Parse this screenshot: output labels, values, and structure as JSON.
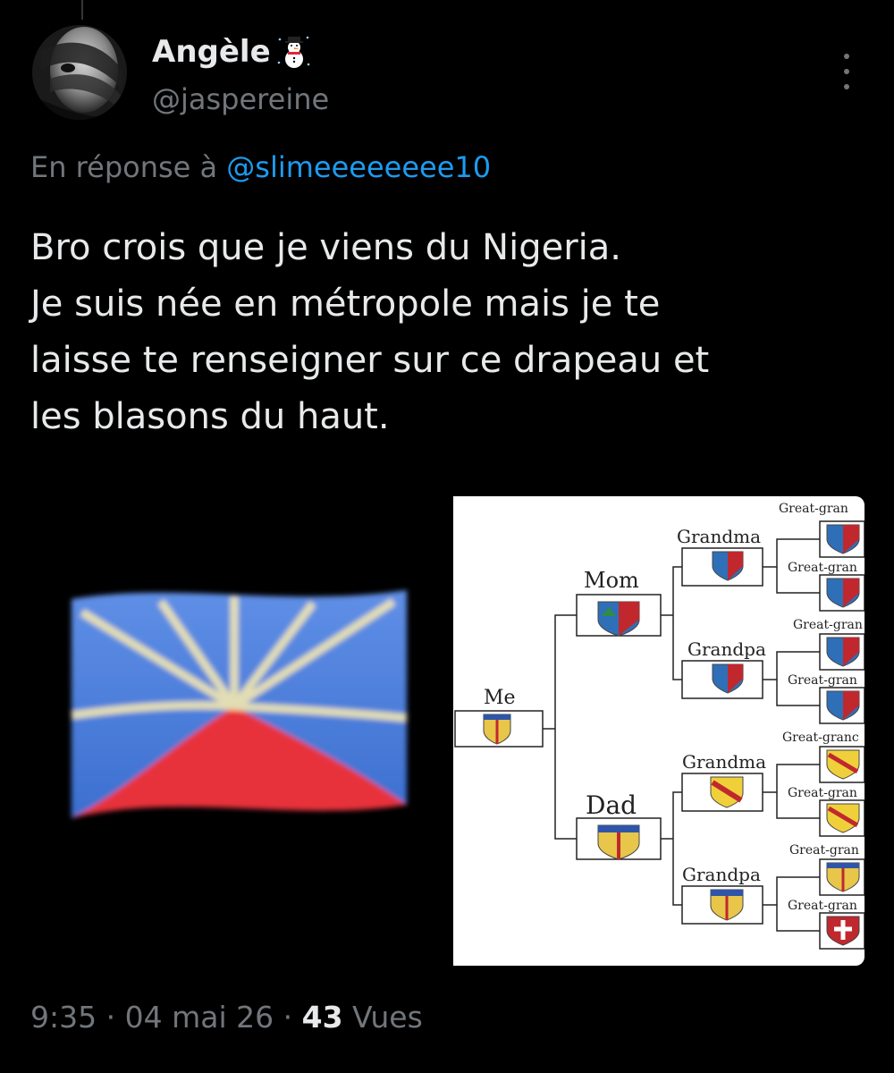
{
  "author": {
    "display_name": "Angèle",
    "handle": "@jaspereine"
  },
  "reply": {
    "prefix": "En réponse à",
    "mention": "@slimeeeeeeee10"
  },
  "tweet": {
    "lines": [
      "Bro crois que je viens du Nigeria.",
      "Je suis née en métropole mais je te",
      "laisse te renseigner sur ce drapeau et",
      "les blasons du haut."
    ]
  },
  "family_tree": {
    "me": "Me",
    "mom": "Mom",
    "dad": "Dad",
    "grandma_mom_side": "Grandma",
    "grandpa_mom_side": "Grandpa",
    "grandma_dad_side": "Grandma",
    "grandpa_dad_side": "Grandpa",
    "great_labels": [
      "Great-gran",
      "Great-gran",
      "Great-gran",
      "Great-gran",
      "Great-granc",
      "Great-gran",
      "Great-gran",
      "Great-gran"
    ]
  },
  "footer": {
    "time": "9:35",
    "date": "04 mai 26",
    "views_count": "43",
    "views_label": "Vues",
    "separator": "·"
  },
  "icons": {
    "more": "more-vertical-icon",
    "emoji": "snowman-icon"
  },
  "colors": {
    "background": "#000000",
    "primary_text": "#e7e9ea",
    "secondary_text": "#71767b",
    "link": "#1d9bf0"
  }
}
